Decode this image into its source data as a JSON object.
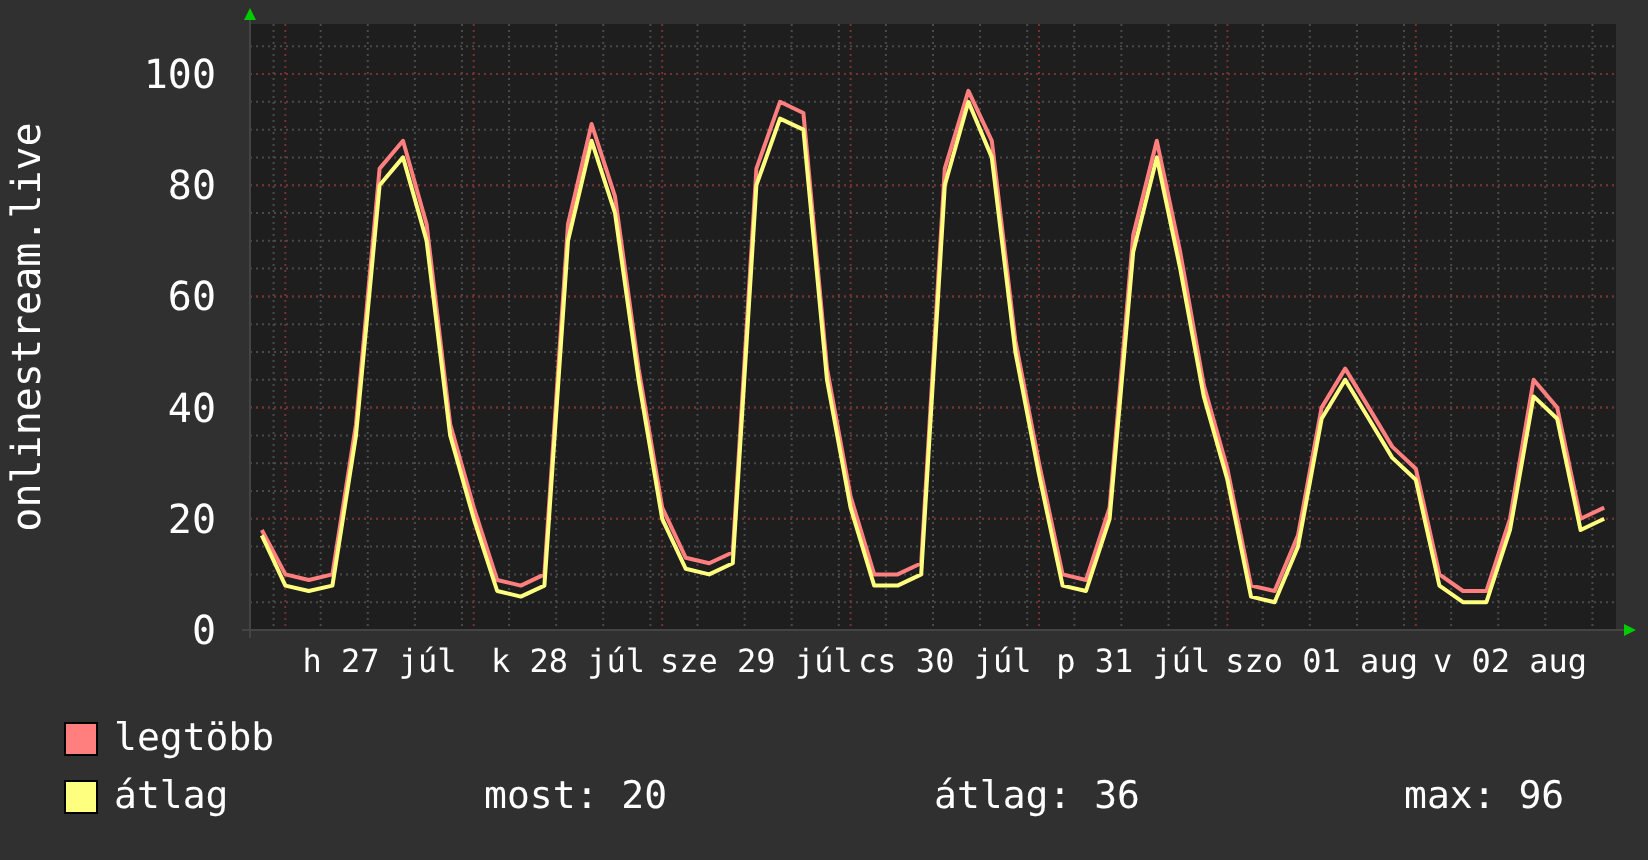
{
  "chart": {
    "chart_data": {
      "type": "line",
      "ylabel": "onlinestream.live",
      "categories": [
        null,
        null,
        null,
        null,
        null,
        "h 27 júl",
        null,
        null,
        null,
        null,
        null,
        null,
        null,
        "k 28 júl",
        null,
        null,
        null,
        null,
        null,
        null,
        null,
        "sze 29 júl",
        null,
        null,
        null,
        null,
        null,
        null,
        null,
        "cs 30 júl",
        null,
        null,
        null,
        null,
        null,
        null,
        null,
        "p 31 júl",
        null,
        null,
        null,
        null,
        null,
        null,
        null,
        "szo 01 aug",
        null,
        null,
        null,
        null,
        null,
        null,
        null,
        "v 02 aug",
        null,
        null,
        null,
        null
      ],
      "series": [
        {
          "name": "legtöbb",
          "color": "#ff7f7f",
          "values": [
            18,
            10,
            9,
            10,
            37,
            83,
            88,
            73,
            37,
            22,
            9,
            8,
            10,
            73,
            91,
            78,
            47,
            22,
            13,
            12,
            14,
            83,
            95,
            93,
            47,
            24,
            10,
            10,
            12,
            83,
            97,
            88,
            52,
            30,
            10,
            9,
            22,
            71,
            88,
            68,
            44,
            29,
            8,
            7,
            17,
            40,
            47,
            40,
            33,
            29,
            10,
            7,
            7,
            20,
            45,
            40,
            20,
            22
          ]
        },
        {
          "name": "átlag",
          "color": "#ffff7f",
          "values": [
            17,
            8,
            7,
            8,
            35,
            80,
            85,
            70,
            35,
            20,
            7,
            6,
            8,
            70,
            88,
            75,
            45,
            20,
            11,
            10,
            12,
            80,
            92,
            90,
            45,
            22,
            8,
            8,
            10,
            80,
            95,
            85,
            50,
            28,
            8,
            7,
            20,
            68,
            85,
            65,
            42,
            27,
            6,
            5,
            15,
            38,
            45,
            38,
            31,
            27,
            8,
            5,
            5,
            18,
            42,
            38,
            18,
            20
          ]
        }
      ],
      "ylim": [
        0,
        109
      ],
      "grid": true,
      "yticks": [
        0,
        20,
        40,
        60,
        80,
        100
      ]
    }
  },
  "stats": [
    "most: 20",
    "átlag: 36",
    "max: 96"
  ]
}
